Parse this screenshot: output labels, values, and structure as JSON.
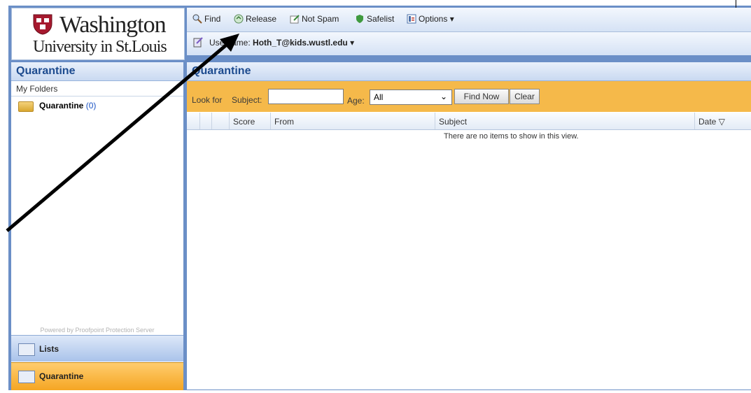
{
  "logo": {
    "title": "Washington",
    "subtitle": "University in St.Louis"
  },
  "left": {
    "header": "Quarantine",
    "my_folders": "My Folders",
    "folder": {
      "label": "Quarantine",
      "count": "(0)"
    },
    "powered_by": "Powered by Proofpoint Protection Server",
    "nav": [
      {
        "label": "Lists",
        "icon": "lists-icon"
      },
      {
        "label": "Quarantine",
        "icon": "quarantine-icon"
      }
    ]
  },
  "toolbar": {
    "find": "Find",
    "release": "Release",
    "not_spam": "Not Spam",
    "safelist": "Safelist",
    "options": "Options ▾"
  },
  "user": {
    "label": "Username:",
    "name": "Hoth_T@kids.wustl.edu"
  },
  "main": {
    "header": "Quarantine",
    "search": {
      "look_for": "Look for",
      "subject_label": "Subject:",
      "subject_value": "",
      "age_label": "Age:",
      "age_value": "All",
      "find_now": "Find Now",
      "clear": "Clear"
    },
    "columns": [
      "Score",
      "From",
      "Subject",
      "Date ▽"
    ],
    "empty_message": "There are no items to show in this view."
  },
  "colors": {
    "accent": "#f5b94a",
    "header_text": "#1d4b8f",
    "frame": "#6b8fc7"
  }
}
